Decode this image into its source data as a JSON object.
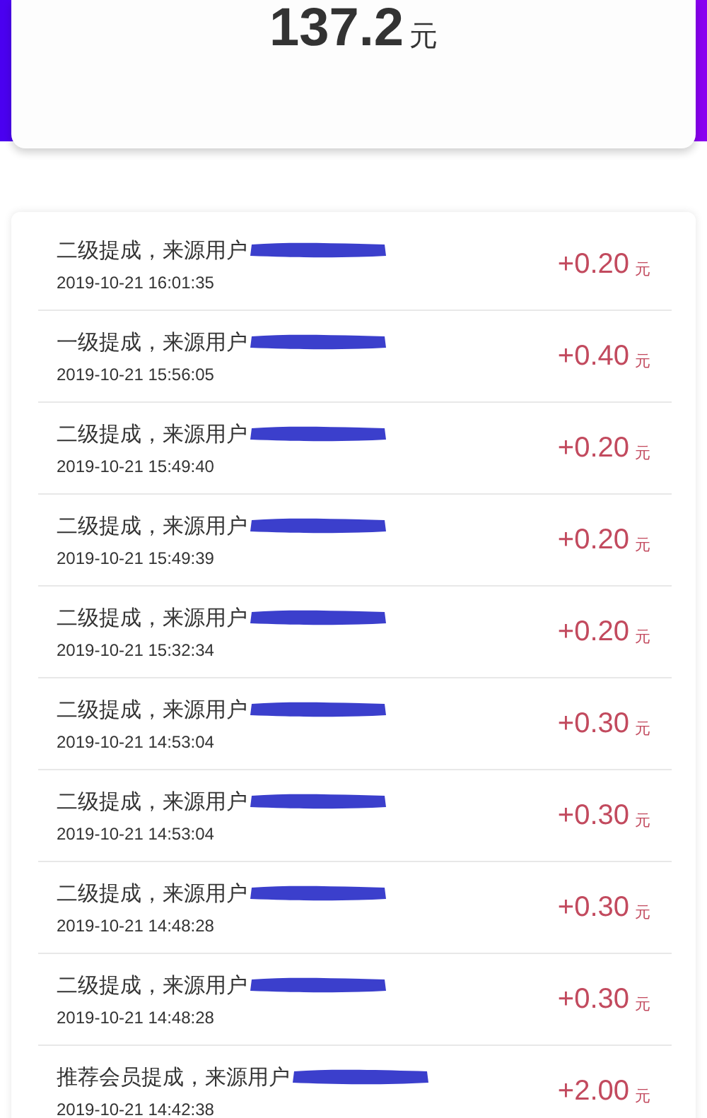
{
  "balance": {
    "amount": "137.2",
    "unit": "元"
  },
  "records": [
    {
      "title": "二级提成，来源用户",
      "time": "2019-10-21 16:01:35",
      "amount": "+0.20",
      "unit": "元"
    },
    {
      "title": "一级提成，来源用户",
      "time": "2019-10-21 15:56:05",
      "amount": "+0.40",
      "unit": "元"
    },
    {
      "title": "二级提成，来源用户",
      "time": "2019-10-21 15:49:40",
      "amount": "+0.20",
      "unit": "元"
    },
    {
      "title": "二级提成，来源用户",
      "time": "2019-10-21 15:49:39",
      "amount": "+0.20",
      "unit": "元"
    },
    {
      "title": "二级提成，来源用户",
      "time": "2019-10-21 15:32:34",
      "amount": "+0.20",
      "unit": "元"
    },
    {
      "title": "二级提成，来源用户",
      "time": "2019-10-21 14:53:04",
      "amount": "+0.30",
      "unit": "元"
    },
    {
      "title": "二级提成，来源用户",
      "time": "2019-10-21 14:53:04",
      "amount": "+0.30",
      "unit": "元"
    },
    {
      "title": "二级提成，来源用户",
      "time": "2019-10-21 14:48:28",
      "amount": "+0.30",
      "unit": "元"
    },
    {
      "title": "二级提成，来源用户",
      "time": "2019-10-21 14:48:28",
      "amount": "+0.30",
      "unit": "元"
    },
    {
      "title": "推荐会员提成，来源用户",
      "time": "2019-10-21 14:42:38",
      "amount": "+2.00",
      "unit": "元"
    }
  ]
}
